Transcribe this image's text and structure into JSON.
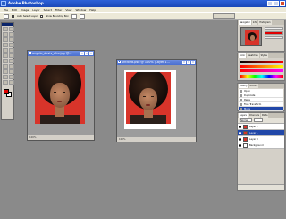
{
  "app": {
    "title": "Adobe Photoshop",
    "colors": {
      "titlebar": "#1a48b8",
      "foreground": "#e00000",
      "background": "#ffffff",
      "canvas_bg": "#d8342a"
    }
  },
  "menu": [
    "File",
    "Edit",
    "Image",
    "Layer",
    "Select",
    "Filter",
    "View",
    "Window",
    "Help"
  ],
  "options_bar": {
    "auto_select_layer": "Auto Select Layer",
    "show_bounding_box": "Show Bounding Box"
  },
  "documents": [
    {
      "title": "angela_davis_afro.jpg @...",
      "status": "100%"
    },
    {
      "title": "untitled-psd @ 100% (Layer 1...",
      "status": "100%"
    }
  ],
  "panels": {
    "navigator_tabs": [
      "Navigator",
      "Info",
      "Histogram"
    ],
    "color_tabs": [
      "Color",
      "Swatches",
      "Styles"
    ],
    "history_tabs": [
      "History",
      "Actions"
    ],
    "history": [
      {
        "label": "Open",
        "selected": false
      },
      {
        "label": "Duplicate",
        "selected": false
      },
      {
        "label": "Paste",
        "selected": false
      },
      {
        "label": "Free Transform",
        "selected": false
      },
      {
        "label": "Move",
        "selected": true
      }
    ],
    "layers_tabs": [
      "Layers",
      "Channels",
      "Paths"
    ],
    "layers_mode": "Normal",
    "layers": [
      {
        "name": "Layer 2",
        "selected": false,
        "bg": false
      },
      {
        "name": "Layer 1",
        "selected": true,
        "bg": false
      },
      {
        "name": "Layer 3",
        "selected": false,
        "bg": false
      },
      {
        "name": "Background",
        "selected": false,
        "bg": true
      }
    ]
  }
}
